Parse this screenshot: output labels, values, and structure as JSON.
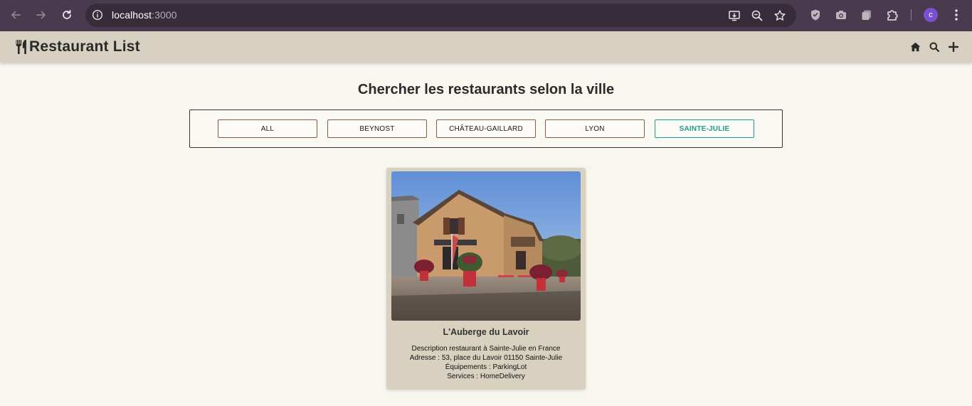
{
  "browser": {
    "url_host": "localhost",
    "url_port": ":3000",
    "profile_initial": "c"
  },
  "navbar": {
    "brand": "Restaurant List",
    "brand_icon": "utensils-icon",
    "actions": [
      "home-icon",
      "search-icon",
      "plus-icon"
    ]
  },
  "main": {
    "title": "Chercher les restaurants selon la ville",
    "filters": [
      {
        "label": "ALL"
      },
      {
        "label": "BEYNOST"
      },
      {
        "label": "CHÂTEAU-GAILLARD"
      },
      {
        "label": "LYON"
      },
      {
        "label": "SAINTE-JULIE"
      }
    ],
    "active_filter": "SAINTE-JULIE"
  },
  "card": {
    "name": "L'Auberge du Lavoir",
    "description": "Description restaurant à Sainte-Julie en France",
    "address": "Adresse : 53, place du Lavoir 01150 Sainte-Julie",
    "equipment": "Équipements : ParkingLot",
    "services": "Services : HomeDelivery"
  },
  "colors": {
    "chrome": "#4a3a4d",
    "navbar": "#d8d1c1",
    "background": "#f9f6ef",
    "accent": "#1aa086",
    "button_border": "#8a5a44",
    "card": "#d9d1c0"
  }
}
